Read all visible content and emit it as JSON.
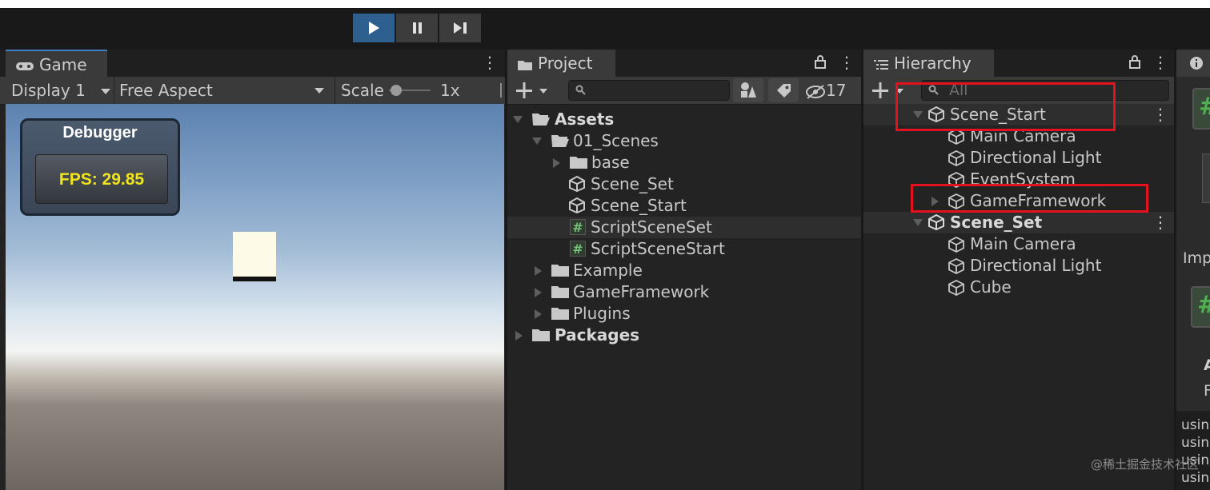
{
  "toolbar": {
    "play": "play-icon",
    "pause": "pause-icon",
    "step": "step-icon"
  },
  "game": {
    "tab_label": "Game",
    "display": "Display 1",
    "aspect": "Free Aspect",
    "scale_label": "Scale",
    "scale_value": "1x",
    "debugger_title": "Debugger",
    "fps_text": "FPS: 29.85"
  },
  "project": {
    "tab_label": "Project",
    "hidden_count": "17",
    "items": [
      "Assets",
      "01_Scenes",
      "base",
      "Scene_Set",
      "Scene_Start",
      "ScriptSceneSet",
      "ScriptSceneStart",
      "Example",
      "GameFramework",
      "Plugins",
      "Packages"
    ]
  },
  "hierarchy": {
    "tab_label": "Hierarchy",
    "search_placeholder": "All",
    "items": [
      "Scene_Start",
      "Main Camera",
      "Directional Light",
      "EventSystem",
      "GameFramework",
      "Scene_Set",
      "Main Camera",
      "Directional Light",
      "Cube"
    ]
  },
  "inspector": {
    "fragments": [
      "Imp",
      "A",
      "F",
      "usin",
      "usin",
      "usin",
      "usin"
    ]
  },
  "watermark": "@稀土掘金技术社区",
  "colors": {
    "highlight": "#e3121e",
    "fps": "#f1e51b",
    "accent": "#2d5f8f"
  }
}
